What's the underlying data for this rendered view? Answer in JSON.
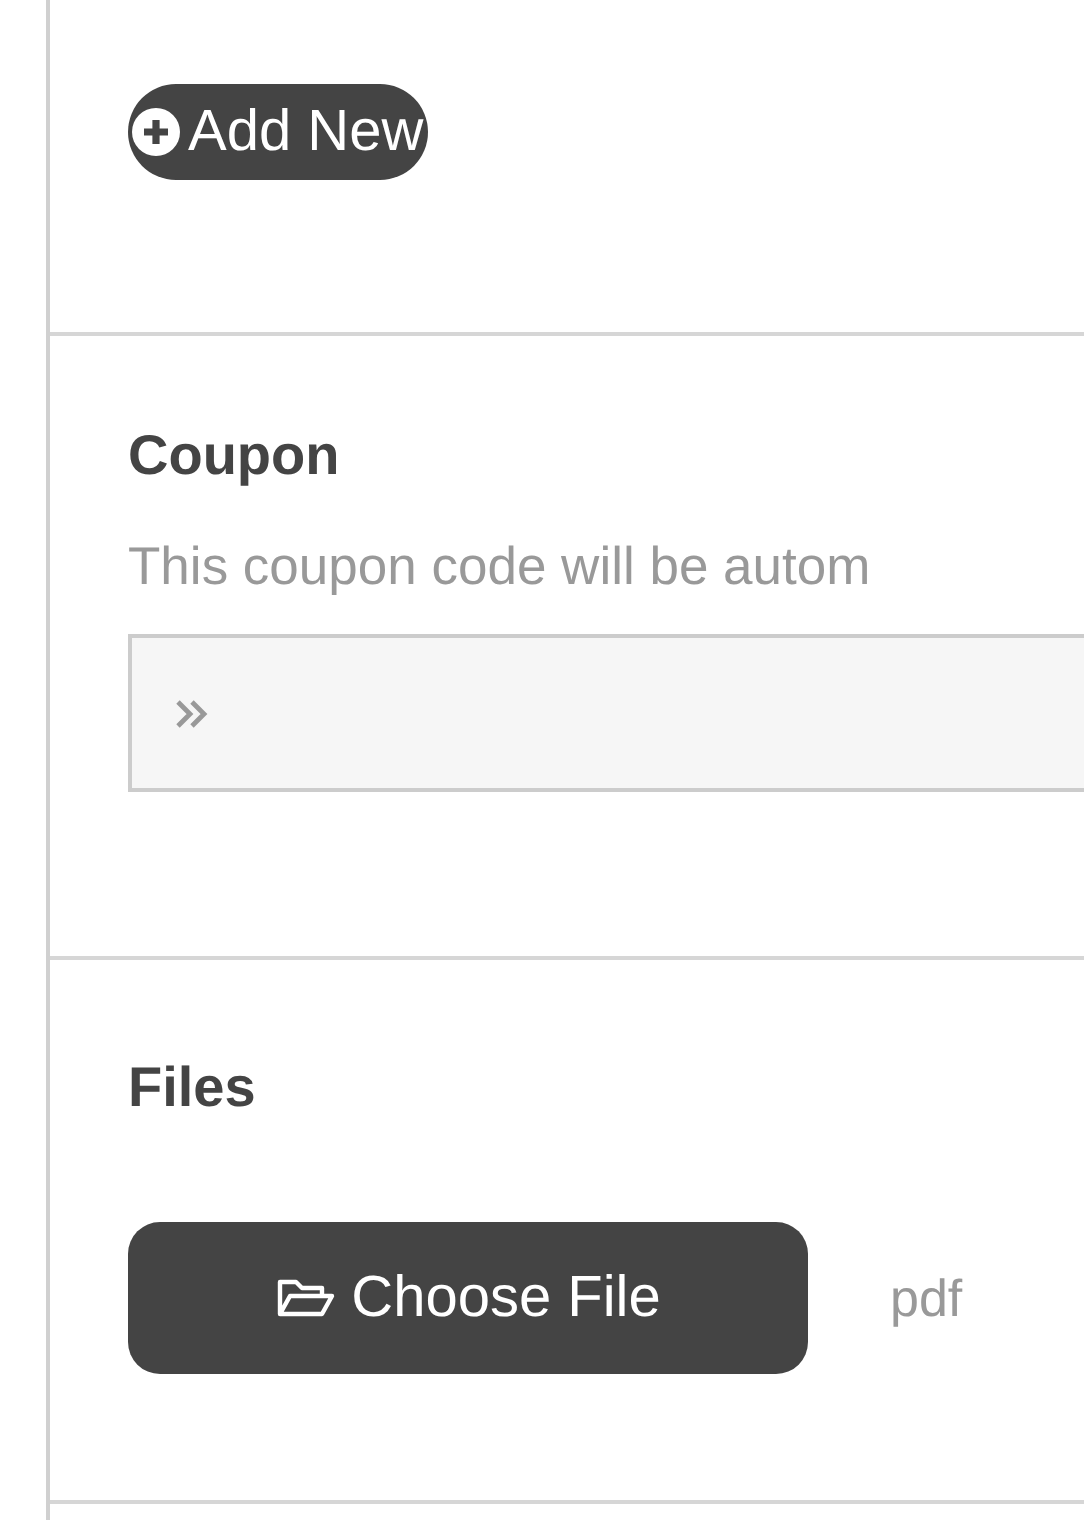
{
  "add_button": {
    "label": "Add New"
  },
  "coupon": {
    "title": "Coupon",
    "description": "This coupon code will be autom"
  },
  "files": {
    "title": "Files",
    "button": "Choose File",
    "accepted": "pdf"
  }
}
